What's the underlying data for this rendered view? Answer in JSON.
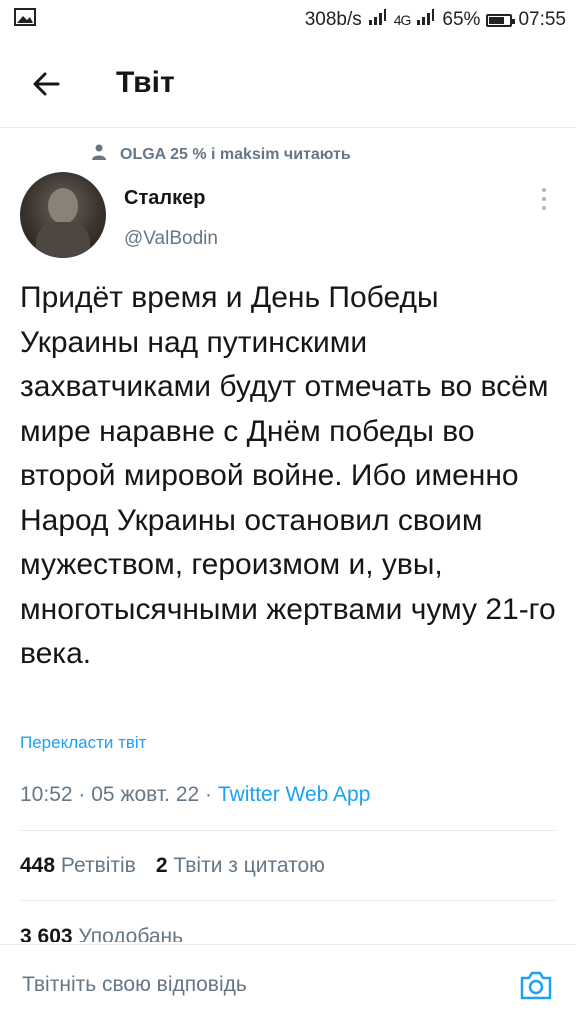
{
  "status_bar": {
    "speed": "308b/s",
    "network": "4G",
    "battery": "65%",
    "battery_level": 0.65,
    "time": "07:55",
    "icons": [
      "image-icon",
      "signal-icon",
      "battery-icon"
    ]
  },
  "header": {
    "title": "Твіт",
    "back_icon": "arrow-left-icon"
  },
  "tweet": {
    "context": "OLGA 25 % і maksim читають",
    "context_icon": "person-icon",
    "author_name": "Сталкер",
    "author_handle": "@ValBodin",
    "text": "Придёт время и День Победы Украины над путинскими захватчиками будут отмечать во всём мире наравне с Днём победы во второй мировой войне. Ибо именно Народ Украины остановил своим мужеством, героизмом и, увы, многотысячными жертвами чуму 21-го века.",
    "translate_label": "Перекласти твіт",
    "time": "10:52",
    "date": "05 жовт. 22",
    "separator": "·",
    "app": "Twitter Web App",
    "retweets_count": "448",
    "retweets_label": "Ретвітів",
    "quotes_count": "2",
    "quotes_label": "Твіти з цитатою",
    "likes_count": "3 603",
    "likes_label": "Уподобань"
  },
  "reply": {
    "placeholder": "Твітніть свою відповідь",
    "camera_icon": "camera-icon"
  },
  "colors": {
    "accent": "#1da1f2",
    "secondary_text": "#657786",
    "divider": "#e6ecf0"
  }
}
